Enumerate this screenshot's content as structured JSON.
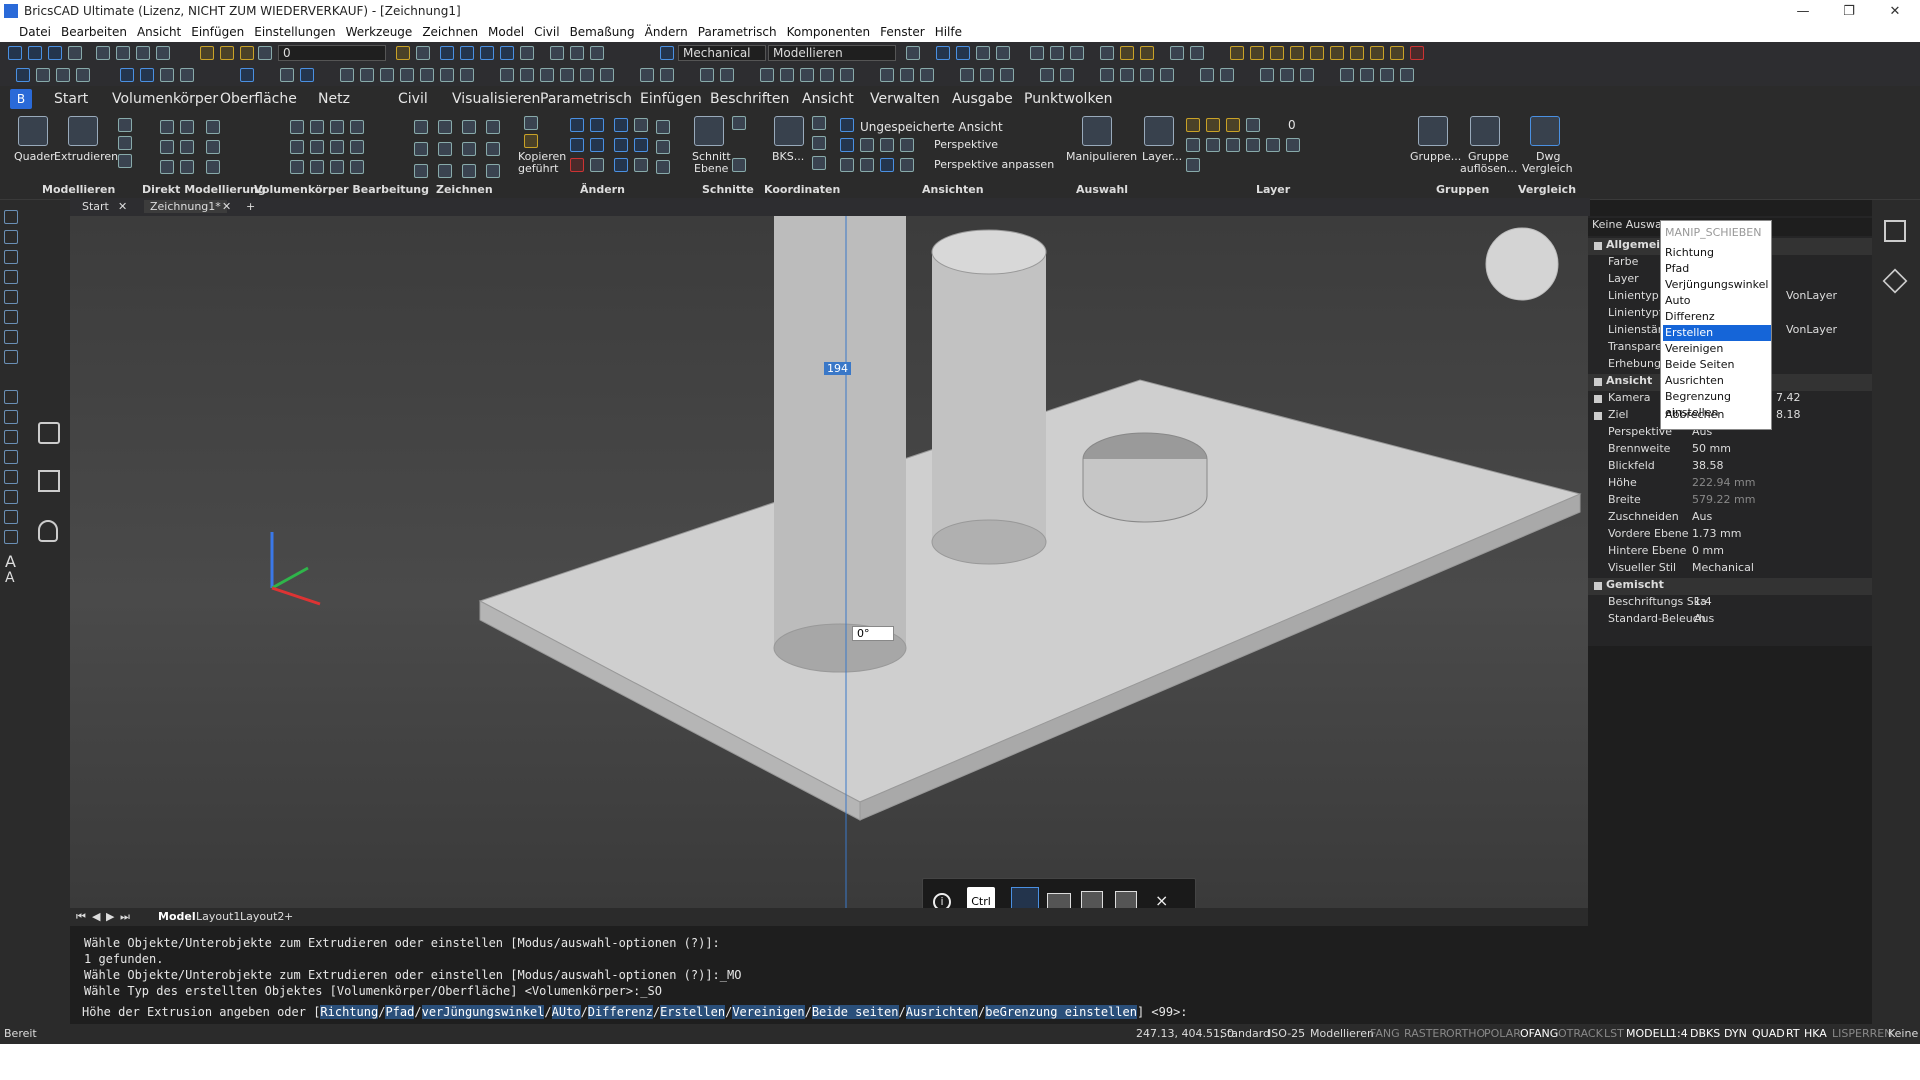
{
  "window": {
    "title": "BricsCAD Ultimate (Lizenz, NICHT ZUM WIEDERVERKAUF) - [Zeichnung1]",
    "controls": [
      "—",
      "❐",
      "✕"
    ]
  },
  "menubar": [
    "Datei",
    "Bearbeiten",
    "Ansicht",
    "Einfügen",
    "Einstellungen",
    "Werkzeuge",
    "Zeichnen",
    "Model",
    "Civil",
    "Bemaßung",
    "Ändern",
    "Parametrisch",
    "Komponenten",
    "Fenster",
    "Hilfe"
  ],
  "toolbar": {
    "layer_combo": "0",
    "workspace_combo": "Mechanical",
    "workspace_mode": "Modellieren"
  },
  "ribbon_tabs": [
    "Start",
    "Volumenkörper",
    "Oberfläche",
    "Netz",
    "Civil",
    "Visualisieren",
    "Parametrisch",
    "Einfügen",
    "Beschriften",
    "Ansicht",
    "Verwalten",
    "Ausgabe",
    "Punktwolken"
  ],
  "ribbon": {
    "labels": {
      "quader": "Quader",
      "extrudieren": "Extrudieren",
      "kopieren": "Kopieren",
      "gefuehrt": "geführt",
      "schnitt": "Schnitt",
      "ebene": "Ebene",
      "bks": "BKS...",
      "view_name": "Ungespeicherte Ansicht",
      "perspektive": "Perspektive",
      "perspektive_anpassen": "Perspektive anpassen",
      "manipulieren": "Manipulieren",
      "layer_btn": "Layer...",
      "layer_value": "0",
      "gruppe": "Gruppe...",
      "gruppe_aufloesen": "Gruppe",
      "gruppe_aufloesen2": "auflösen...",
      "dwg": "Dwg",
      "vergleich": "Vergleich"
    },
    "groups": [
      "Modellieren",
      "Direkt Modellierung",
      "Volumenkörper Bearbeitung",
      "Zeichnen",
      "Ändern",
      "Schnitte",
      "Koordinaten",
      "Ansichten",
      "Auswahl",
      "Layer",
      "Gruppen",
      "Vergleich"
    ]
  },
  "doc_tabs": {
    "tab1": "Start",
    "tab2": "Zeichnung1*",
    "close": "✕",
    "add": "+"
  },
  "viewport": {
    "dim_value": "194",
    "angle_value": "0°"
  },
  "layout_tabs": [
    "Model",
    "Layout1",
    "Layout2",
    "+"
  ],
  "quad": {
    "ctrl_label": "Ctrl",
    "close": "×",
    "info": "i"
  },
  "properties": {
    "selection": "Keine Auswahl",
    "sections": {
      "allgemein": "Allgemein",
      "ansicht": "Ansicht",
      "gemischt": "Gemischt"
    },
    "rows_general": [
      {
        "k": "Farbe",
        "v": ""
      },
      {
        "k": "Layer",
        "v": ""
      },
      {
        "k": "Linientyp",
        "v": "VonLayer"
      },
      {
        "k": "Linientypfaktor",
        "v": ""
      },
      {
        "k": "Linienstärke",
        "v": "VonLayer"
      },
      {
        "k": "Transparenz",
        "v": ""
      },
      {
        "k": "Erhebung",
        "v": ""
      }
    ],
    "rows_view": [
      {
        "k": "Kamera",
        "v": "7.42"
      },
      {
        "k": "Ziel",
        "v": "8.18"
      },
      {
        "k": "Perspektive",
        "v": "Aus"
      },
      {
        "k": "Brennweite",
        "v": "50 mm"
      },
      {
        "k": "Blickfeld",
        "v": "38.58"
      },
      {
        "k": "Höhe",
        "v": "222.94 mm"
      },
      {
        "k": "Breite",
        "v": "579.22 mm"
      },
      {
        "k": "Zuschneiden",
        "v": "Aus"
      },
      {
        "k": "Vordere Ebene",
        "v": "1.73 mm"
      },
      {
        "k": "Hintere Ebene",
        "v": "0 mm"
      },
      {
        "k": "Visueller Stil",
        "v": "Mechanical"
      }
    ],
    "rows_mixed": [
      {
        "k": "Beschriftungs Ska",
        "v": "1:4"
      },
      {
        "k": "Standard-Beleuch",
        "v": "Aus"
      }
    ]
  },
  "context_menu": {
    "header": "MANIP_SCHIEBEN",
    "items": [
      "Richtung",
      "Pfad",
      "Verjüngungswinkel",
      "Auto",
      "Differenz",
      "Erstellen",
      "Vereinigen",
      "Beide Seiten",
      "Ausrichten",
      "Begrenzung einstellen",
      "Abbrechen"
    ],
    "selected_index": 5
  },
  "command_history": [
    "Wähle Objekte/Unterobjekte zum Extrudieren oder einstellen [Modus/auswahl-optionen (?)]:",
    "1 gefunden.",
    "Wähle Objekte/Unterobjekte zum Extrudieren oder einstellen [Modus/auswahl-optionen (?)]:_MO",
    "Wähle Typ des erstellten Objektes [Volumenkörper/Oberfläche] <Volumenkörper>:_SO"
  ],
  "command_line": {
    "prefix": "Höhe der Extrusion angeben oder [",
    "options": [
      "Richtung",
      "Pfad",
      "verJüngungswinkel",
      "AUto",
      "Differenz",
      "Erstellen",
      "Vereinigen",
      "Beide seiten",
      "Ausrichten",
      "beGrenzung einstellen"
    ],
    "suffix": "] <99>:"
  },
  "statusbar": {
    "left": "Bereit",
    "coords": "247.13, 404.51, 0",
    "items": [
      "Standard",
      "ISO-25",
      "Modellieren",
      "FANG",
      "RASTER",
      "ORTHO",
      "POLAR",
      "OFANG",
      "OTRACK",
      "LST",
      "MODELL",
      "1:4",
      "DBKS",
      "DYN",
      "QUAD",
      "RT",
      "HKA",
      "LISPERREN",
      "Keine"
    ]
  },
  "colors": {
    "accent": "#1565d8",
    "panel": "#2b2b2b",
    "viewport_top": "#3c3c3c"
  }
}
